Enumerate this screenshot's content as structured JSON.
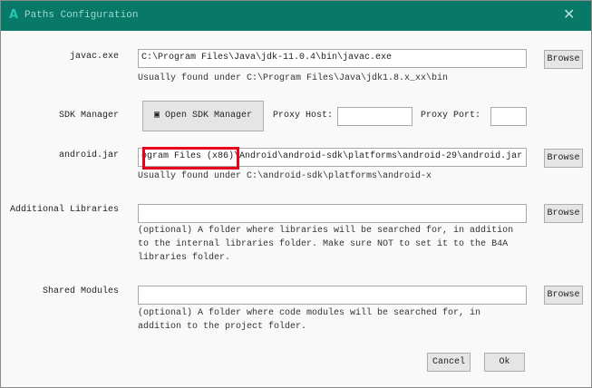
{
  "window": {
    "title": "Paths Configuration",
    "logo": "A",
    "close": "✕"
  },
  "javac": {
    "label": "javac.exe",
    "value": "C:\\Program Files\\Java\\jdk-11.0.4\\bin\\javac.exe",
    "hint": "Usually found under C:\\Program Files\\Java\\jdk1.8.x_xx\\bin",
    "browse": "Browse"
  },
  "sdk": {
    "label": "SDK Manager",
    "button": "Open SDK Manager",
    "proxy_host_label": "Proxy Host:",
    "proxy_host": "",
    "proxy_port_label": "Proxy Port:",
    "proxy_port": ""
  },
  "android_jar": {
    "label": "android.jar",
    "value": "ogram Files (x86)\\Android\\android-sdk\\platforms\\android-29\\android.jar",
    "hint": "Usually found under C:\\android-sdk\\platforms\\android-x",
    "browse": "Browse"
  },
  "additional": {
    "label": "Additional Libraries",
    "value": "",
    "hint": [
      "(optional) A folder where libraries will be searched for, in addition",
      "to the internal libraries folder. Make sure NOT to set it to the B4A",
      "libraries folder."
    ],
    "browse": "Browse"
  },
  "shared": {
    "label": "Shared Modules",
    "value": "",
    "hint": [
      "(optional) A folder where code modules will be searched for, in",
      "addition to the project folder."
    ],
    "browse": "Browse"
  },
  "footer": {
    "cancel": "Cancel",
    "ok": "Ok"
  },
  "colors": {
    "titlebar": "#087868",
    "highlight": "#e8001c"
  }
}
